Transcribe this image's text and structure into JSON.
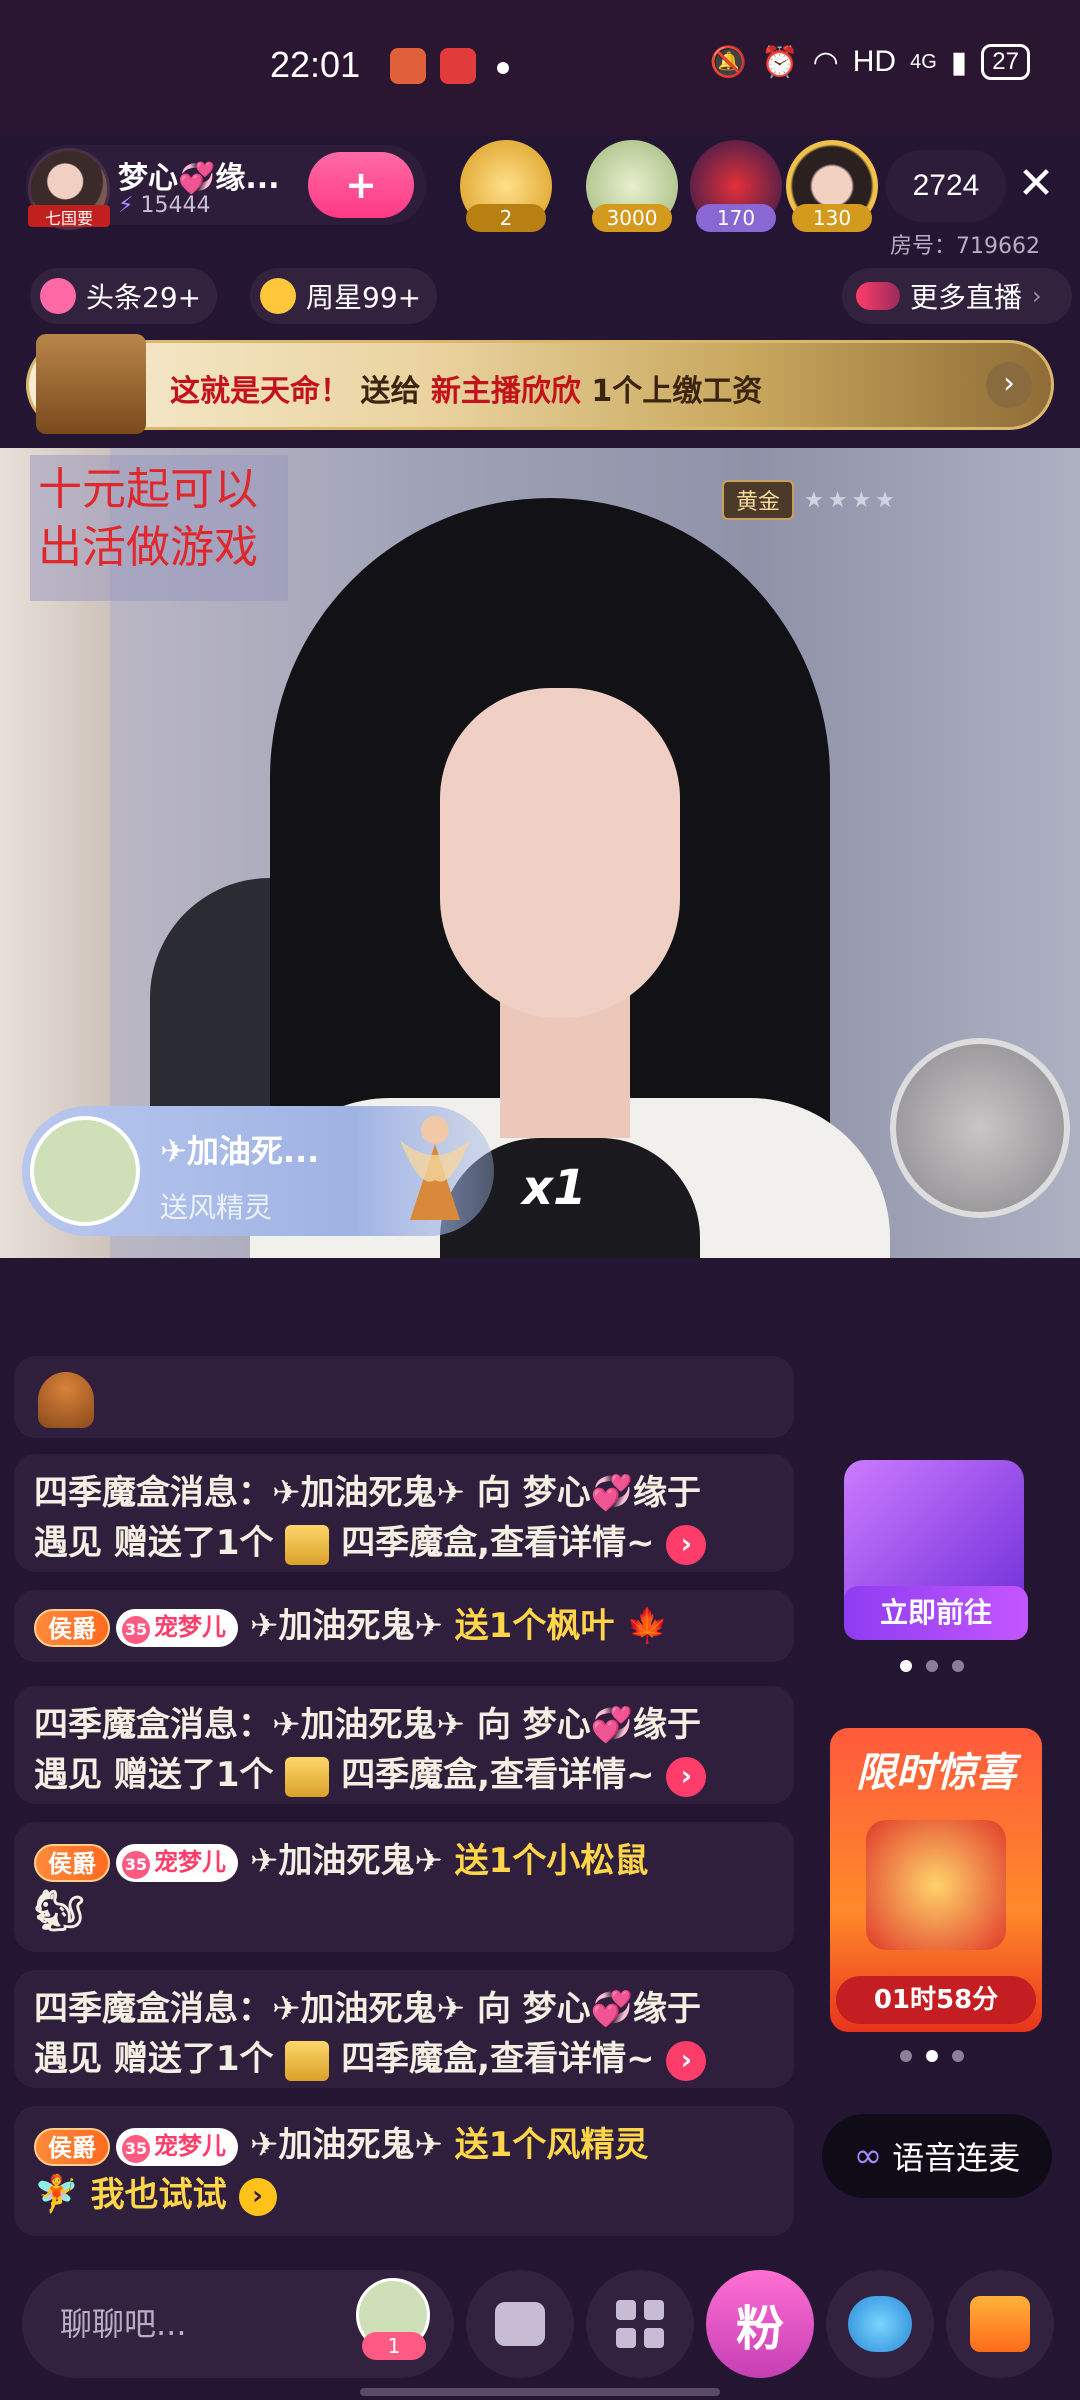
{
  "status_bar": {
    "time": "22:01",
    "network": "HD",
    "signal": "4G",
    "battery": "27"
  },
  "header": {
    "anchor_name": "梦心💞缘...",
    "anchor_fans": "15444",
    "anchor_tag": "七国要",
    "follow_icon": "+",
    "ranks": [
      {
        "badge": "2"
      },
      {
        "badge": "3000"
      },
      {
        "badge": "170"
      },
      {
        "badge": "130"
      }
    ],
    "viewer_count": "2724",
    "room_no": "房号：719662",
    "chips": [
      {
        "label": "头条29+"
      },
      {
        "label": "周星99+"
      }
    ],
    "more_live": "更多直播",
    "banner": {
      "part1": "这就是天命！",
      "part2": " 送给 ",
      "part3": "新主播欣欣",
      "part4": " 1个上缴工资"
    }
  },
  "video": {
    "sign_line1": "十元起可以",
    "sign_line2": "出活做游戏",
    "rank_level": "黄金",
    "rank_stars": "★★★★",
    "gift_toast": {
      "name": "✈加油死...",
      "desc": "送风精灵",
      "count": "x1"
    }
  },
  "chat": {
    "messages": [
      {
        "type": "system",
        "line1": "四季魔盒消息：✈加油死鬼✈ 向 梦心💞缘于",
        "line2a": "遇见 赠送了1个",
        "line2b": "四季魔盒,查看详情~"
      },
      {
        "type": "gift",
        "rank": "侯爵",
        "fan_level": "35",
        "fan_name": "宠梦儿",
        "user": "✈加油死鬼✈",
        "gift": "送1个枫叶"
      },
      {
        "type": "system",
        "line1": "四季魔盒消息：✈加油死鬼✈ 向 梦心💞缘于",
        "line2a": "遇见 赠送了1个",
        "line2b": "四季魔盒,查看详情~"
      },
      {
        "type": "gift",
        "rank": "侯爵",
        "fan_level": "35",
        "fan_name": "宠梦儿",
        "user": "✈加油死鬼✈",
        "gift": "送1个小松鼠"
      },
      {
        "type": "system",
        "line1": "四季魔盒消息：✈加油死鬼✈ 向 梦心💞缘于",
        "line2a": "遇见 赠送了1个",
        "line2b": "四季魔盒,查看详情~"
      },
      {
        "type": "gift",
        "rank": "侯爵",
        "fan_level": "35",
        "fan_name": "宠梦儿",
        "user": "✈加油死鬼✈",
        "gift": "送1个风精灵",
        "action": "我也试试"
      }
    ]
  },
  "side": {
    "magic_box_button": "立即前往",
    "surprise_title": "限时惊喜",
    "surprise_time": "01时58分",
    "voice_link": "语音连麦"
  },
  "bottom": {
    "input_placeholder": "聊聊吧...",
    "input_badge": "1",
    "fan_button": "粉"
  }
}
